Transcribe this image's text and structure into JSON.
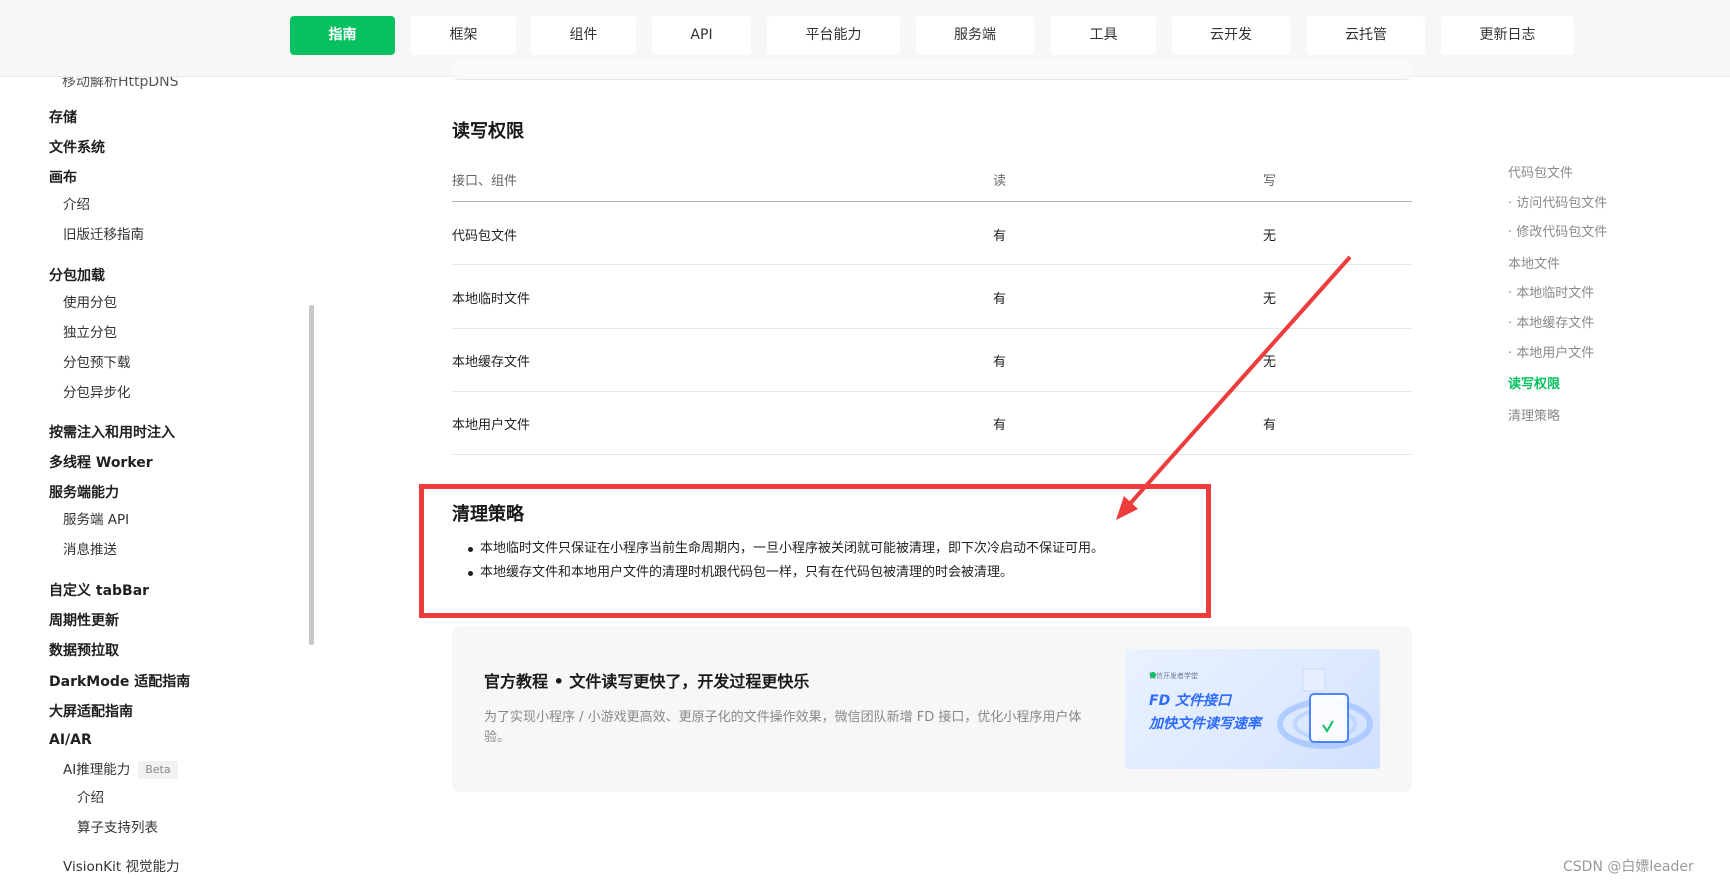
{
  "nav": {
    "tabs": [
      "指南",
      "框架",
      "组件",
      "API",
      "平台能力",
      "服务端",
      "工具",
      "云开发",
      "云托管",
      "更新日志"
    ],
    "active_index": 0,
    "accent": "#07c160"
  },
  "sidebar": {
    "cut_item": "移动解析HttpDNS",
    "items": [
      {
        "label": "存储",
        "type": "head"
      },
      {
        "label": "文件系统",
        "type": "head"
      },
      {
        "label": "画布",
        "type": "head"
      },
      {
        "label": "介绍",
        "type": "sub"
      },
      {
        "label": "旧版迁移指南",
        "type": "sub"
      },
      {
        "label": "分包加载",
        "type": "head"
      },
      {
        "label": "使用分包",
        "type": "sub"
      },
      {
        "label": "独立分包",
        "type": "sub"
      },
      {
        "label": "分包预下载",
        "type": "sub"
      },
      {
        "label": "分包异步化",
        "type": "sub"
      },
      {
        "label": "按需注入和用时注入",
        "type": "head"
      },
      {
        "label": "多线程 Worker",
        "type": "head"
      },
      {
        "label": "服务端能力",
        "type": "head"
      },
      {
        "label": "服务端 API",
        "type": "sub"
      },
      {
        "label": "消息推送",
        "type": "sub"
      },
      {
        "label": "自定义 tabBar",
        "type": "head"
      },
      {
        "label": "周期性更新",
        "type": "head"
      },
      {
        "label": "数据预拉取",
        "type": "head"
      },
      {
        "label": "DarkMode 适配指南",
        "type": "head"
      },
      {
        "label": "大屏适配指南",
        "type": "head"
      },
      {
        "label": "AI/AR",
        "type": "head"
      },
      {
        "label": "AI推理能力",
        "type": "sub",
        "badge": "Beta"
      },
      {
        "label": "介绍",
        "type": "sub2"
      },
      {
        "label": "算子支持列表",
        "type": "sub2"
      },
      {
        "label": "VisionKit 视觉能力",
        "type": "sub"
      }
    ]
  },
  "main": {
    "section1_title": "读写权限",
    "table": {
      "headers": [
        "接口、组件",
        "读",
        "写"
      ],
      "rows": [
        [
          "代码包文件",
          "有",
          "无"
        ],
        [
          "本地临时文件",
          "有",
          "无"
        ],
        [
          "本地缓存文件",
          "有",
          "无"
        ],
        [
          "本地用户文件",
          "有",
          "有"
        ]
      ]
    },
    "section2_title": "清理策略",
    "bullets": [
      "本地临时文件只保证在小程序当前生命周期内，一旦小程序被关闭就可能被清理，即下次冷启动不保证可用。",
      "本地缓存文件和本地用户文件的清理时机跟代码包一样，只有在代码包被清理的时会被清理。"
    ],
    "annotation_color": "#ee3b3b",
    "card": {
      "title": "官方教程 • 文件读写更快了，开发过程更快乐",
      "desc": "为了实现小程序 / 小游戏更高效、更原子化的文件操作效果，微信团队新增 FD 接口，优化小程序用户体验。",
      "image_top": "微信开发者学堂",
      "image_line1": "FD 文件接口",
      "image_line2": "加快文件读写速率"
    }
  },
  "toc": {
    "items": [
      {
        "label": "代码包文件",
        "type": "top"
      },
      {
        "label": "· 访问代码包文件",
        "type": "sub"
      },
      {
        "label": "· 修改代码包文件",
        "type": "sub"
      },
      {
        "label": "本地文件",
        "type": "top"
      },
      {
        "label": "· 本地临时文件",
        "type": "sub"
      },
      {
        "label": "· 本地缓存文件",
        "type": "sub"
      },
      {
        "label": "· 本地用户文件",
        "type": "sub"
      },
      {
        "label": "读写权限",
        "type": "active"
      },
      {
        "label": "清理策略",
        "type": "top"
      }
    ]
  },
  "watermark": "CSDN @白嫖leader"
}
